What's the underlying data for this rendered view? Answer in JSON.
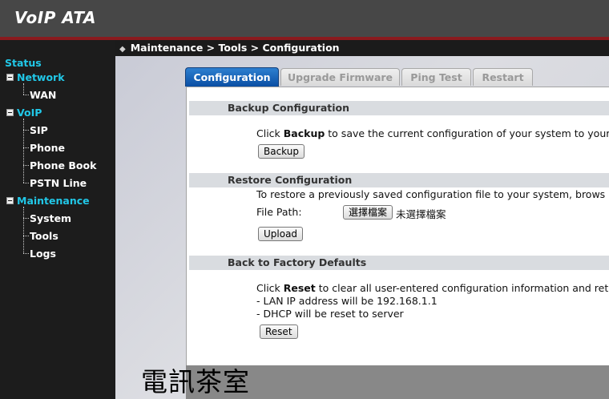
{
  "app": {
    "title": "VoIP ATA"
  },
  "breadcrumb": {
    "text": "Maintenance > Tools > Configuration"
  },
  "sidebar": {
    "status": "Status",
    "network": "Network",
    "wan": "WAN",
    "voip": "VoIP",
    "sip": "SIP",
    "phone": "Phone",
    "phone_book": "Phone Book",
    "pstn_line": "PSTN Line",
    "maintenance": "Maintenance",
    "system": "System",
    "tools": "Tools",
    "logs": "Logs"
  },
  "tabs": {
    "configuration": "Configuration",
    "upgrade_firmware": "Upgrade Firmware",
    "ping_test": "Ping Test",
    "restart": "Restart"
  },
  "backup": {
    "title": "Backup Configuration",
    "desc_pre": "Click ",
    "desc_bold": "Backup",
    "desc_post": " to save the current configuration of your system to your",
    "button": "Backup"
  },
  "restore": {
    "title": "Restore Configuration",
    "desc": "To restore a previously saved configuration file to your system, brows",
    "file_label": "File Path:",
    "choose_button": "選擇檔案",
    "no_file": "未選擇檔案",
    "upload_button": "Upload"
  },
  "factory": {
    "title": "Back to Factory Defaults",
    "desc_pre": "Click ",
    "desc_bold": "Reset",
    "desc_post": " to clear all user-entered configuration information and retu",
    "line1": "- LAN IP address will be 192.168.1.1",
    "line2": "- DHCP will be reset to server",
    "button": "Reset"
  },
  "watermark": "電訊茶室",
  "colors": {
    "accent_cyan": "#21c8e8",
    "header_red": "#8a1a1e",
    "tab_blue": "#0a4ea3"
  }
}
